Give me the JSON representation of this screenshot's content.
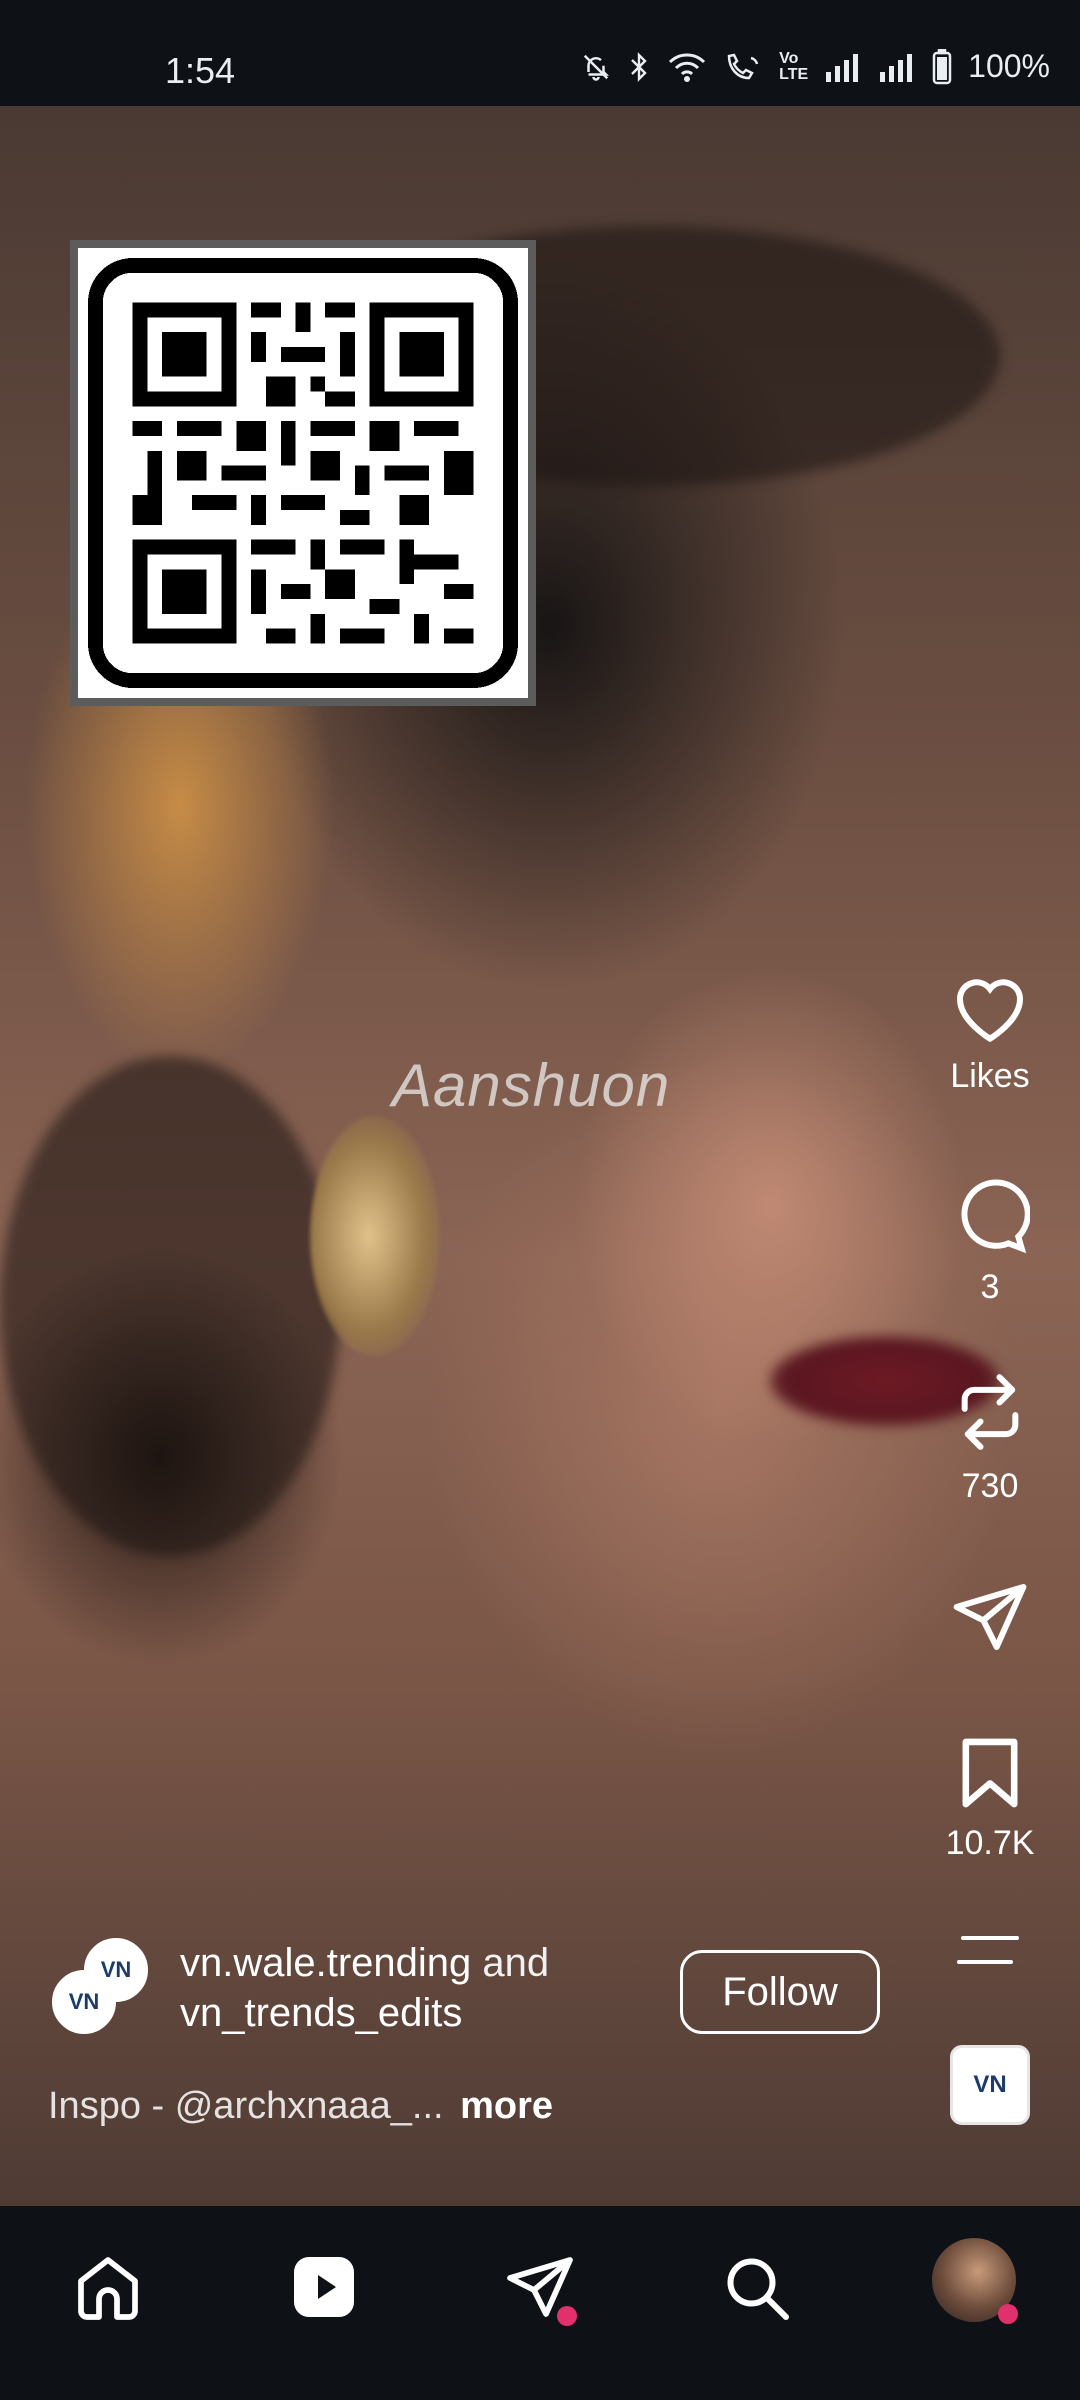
{
  "status_bar": {
    "time": "1:54",
    "battery": "100%",
    "icons": [
      "mute-icon",
      "bluetooth-icon",
      "wifi-icon",
      "wifi-calling-icon",
      "volte-icon",
      "signal-icon",
      "signal-icon",
      "battery-icon"
    ]
  },
  "video": {
    "watermark": "Aanshuon"
  },
  "actions": {
    "likes_label": "Likes",
    "comments_count": "3",
    "reposts_count": "730",
    "saves_count": "10.7K"
  },
  "post": {
    "author_1": "vn.wale.trending",
    "and_text": " and",
    "author_2": "vn_trends_edits",
    "follow_label": "Follow",
    "caption": "Inspo - @archxnaaa_...",
    "more_label": "more",
    "avatar_text": "VN",
    "audio_text": "VN"
  },
  "nav": {
    "items": [
      "home-icon",
      "reels-icon",
      "direct-icon",
      "search-icon",
      "profile-avatar"
    ]
  },
  "colors": {
    "notification_dot": "#e1306c",
    "nav_background": "#0e1217"
  }
}
